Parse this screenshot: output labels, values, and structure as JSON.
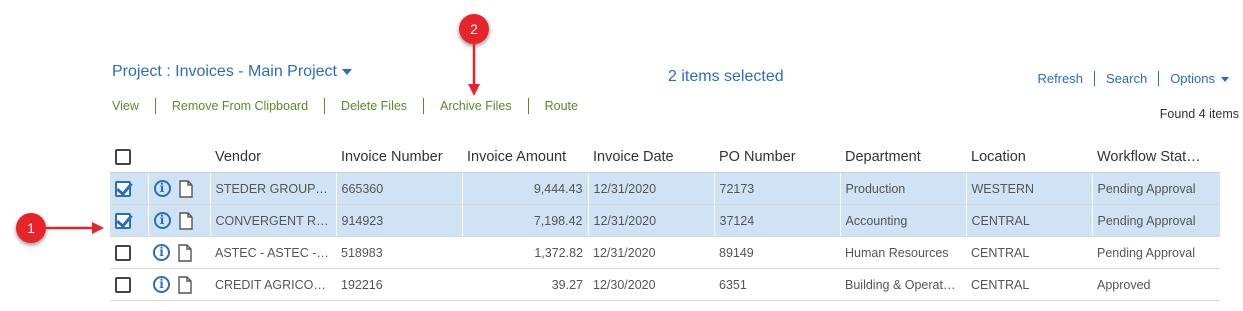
{
  "header": {
    "title": "Project : Invoices - Main Project",
    "selection_status": "2 items selected",
    "links": [
      "Refresh",
      "Search",
      "Options"
    ]
  },
  "actions": [
    "View",
    "Remove From Clipboard",
    "Delete Files",
    "Archive Files",
    "Route"
  ],
  "found_text": "Found 4 items",
  "table": {
    "columns": [
      "Vendor",
      "Invoice Number",
      "Invoice Amount",
      "Invoice Date",
      "PO Number",
      "Department",
      "Location",
      "Workflow Stat…"
    ],
    "rows": [
      {
        "selected": true,
        "vendor": "STEDER GROUP - …",
        "invoice_number": "665360",
        "amount": "9,444.43",
        "date": "12/31/2020",
        "po": "72173",
        "department": "Production",
        "location": "WESTERN",
        "status": "Pending Approval"
      },
      {
        "selected": true,
        "vendor": "CONVERGENT RE…",
        "invoice_number": "914923",
        "amount": "7,198.42",
        "date": "12/31/2020",
        "po": "37124",
        "department": "Accounting",
        "location": "CENTRAL",
        "status": "Pending Approval"
      },
      {
        "selected": false,
        "vendor": "ASTEC - ASTEC - A…",
        "invoice_number": "518983",
        "amount": "1,372.82",
        "date": "12/31/2020",
        "po": "89149",
        "department": "Human Resources",
        "location": "CENTRAL",
        "status": "Pending Approval"
      },
      {
        "selected": false,
        "vendor": "CREDIT AGRICOL…",
        "invoice_number": "192216",
        "amount": "39.27",
        "date": "12/30/2020",
        "po": "6351",
        "department": "Building & Operat…",
        "location": "CENTRAL",
        "status": "Approved"
      }
    ]
  },
  "callouts": [
    "1",
    "2"
  ],
  "colors": {
    "accent": "#2a6ebb",
    "action_green": "#5a8a2a",
    "selected_row": "#cfe3f5",
    "callout_red": "#e8242a"
  },
  "icons": [
    "chevron-down-icon",
    "info-icon",
    "document-icon",
    "checkbox-icon",
    "arrow-icon"
  ]
}
